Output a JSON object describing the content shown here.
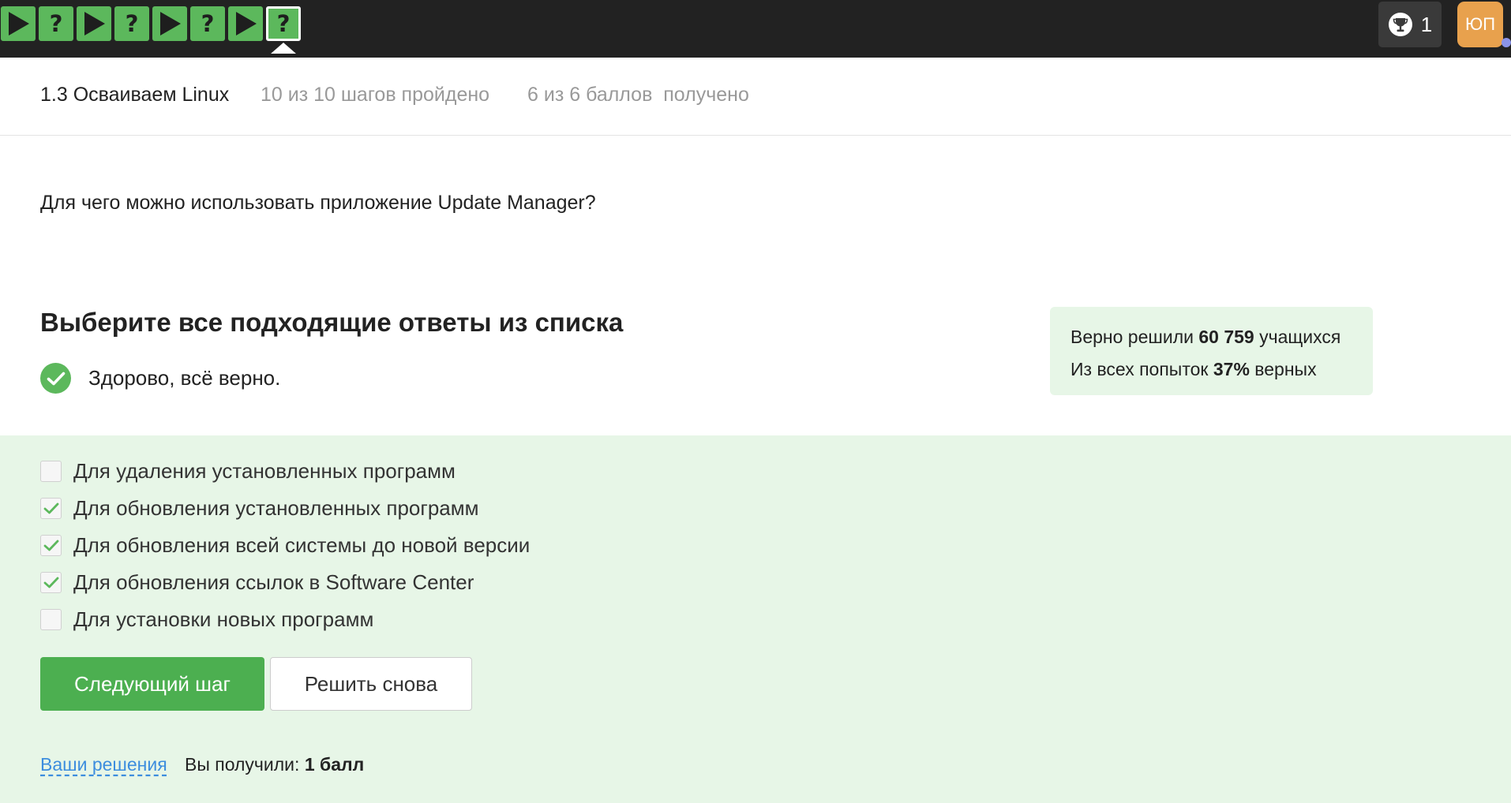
{
  "topbar": {
    "steps": [
      {
        "type": "play",
        "icon": "play-icon"
      },
      {
        "type": "question",
        "label": "?"
      },
      {
        "type": "play",
        "icon": "play-icon"
      },
      {
        "type": "question",
        "label": "?"
      },
      {
        "type": "play",
        "icon": "play-icon"
      },
      {
        "type": "question",
        "label": "?"
      },
      {
        "type": "play",
        "icon": "play-icon"
      },
      {
        "type": "question",
        "label": "?",
        "active": true
      }
    ],
    "trophy_count": "1",
    "avatar_initials": "ЮП"
  },
  "lesson": {
    "title": "1.3 Осваиваем Linux",
    "steps_progress": "10 из 10 шагов пройдено",
    "points_progress": "6 из 6 баллов  получено"
  },
  "question": "Для чего можно использовать приложение Update Manager?",
  "answer_heading": "Выберите все подходящие ответы из списка",
  "success_message": "Здорово, всё верно.",
  "stats": {
    "line1_prefix": "Верно решили ",
    "line1_value": "60 759",
    "line1_suffix": " учащихся",
    "line2_prefix": "Из всех попыток ",
    "line2_value": "37%",
    "line2_suffix": " верных"
  },
  "options": [
    {
      "label": "Для удаления установленных программ",
      "checked": false
    },
    {
      "label": "Для обновления установленных программ",
      "checked": true
    },
    {
      "label": "Для обновления всей системы до новой версии",
      "checked": true
    },
    {
      "label": "Для обновления ссылок в Software Center",
      "checked": true
    },
    {
      "label": "Для установки новых программ",
      "checked": false
    }
  ],
  "buttons": {
    "next": "Следующий шаг",
    "retry": "Решить снова"
  },
  "footer": {
    "solutions_link": "Ваши решения",
    "score_prefix": "Вы получили: ",
    "score_value": "1 балл"
  },
  "colors": {
    "accent_green": "#5cb85c",
    "button_green": "#4caf50",
    "answers_bg": "#e7f6e7",
    "topbar_bg": "#222222",
    "avatar_bg": "#e8a14d",
    "link_blue": "#3c8dde"
  }
}
